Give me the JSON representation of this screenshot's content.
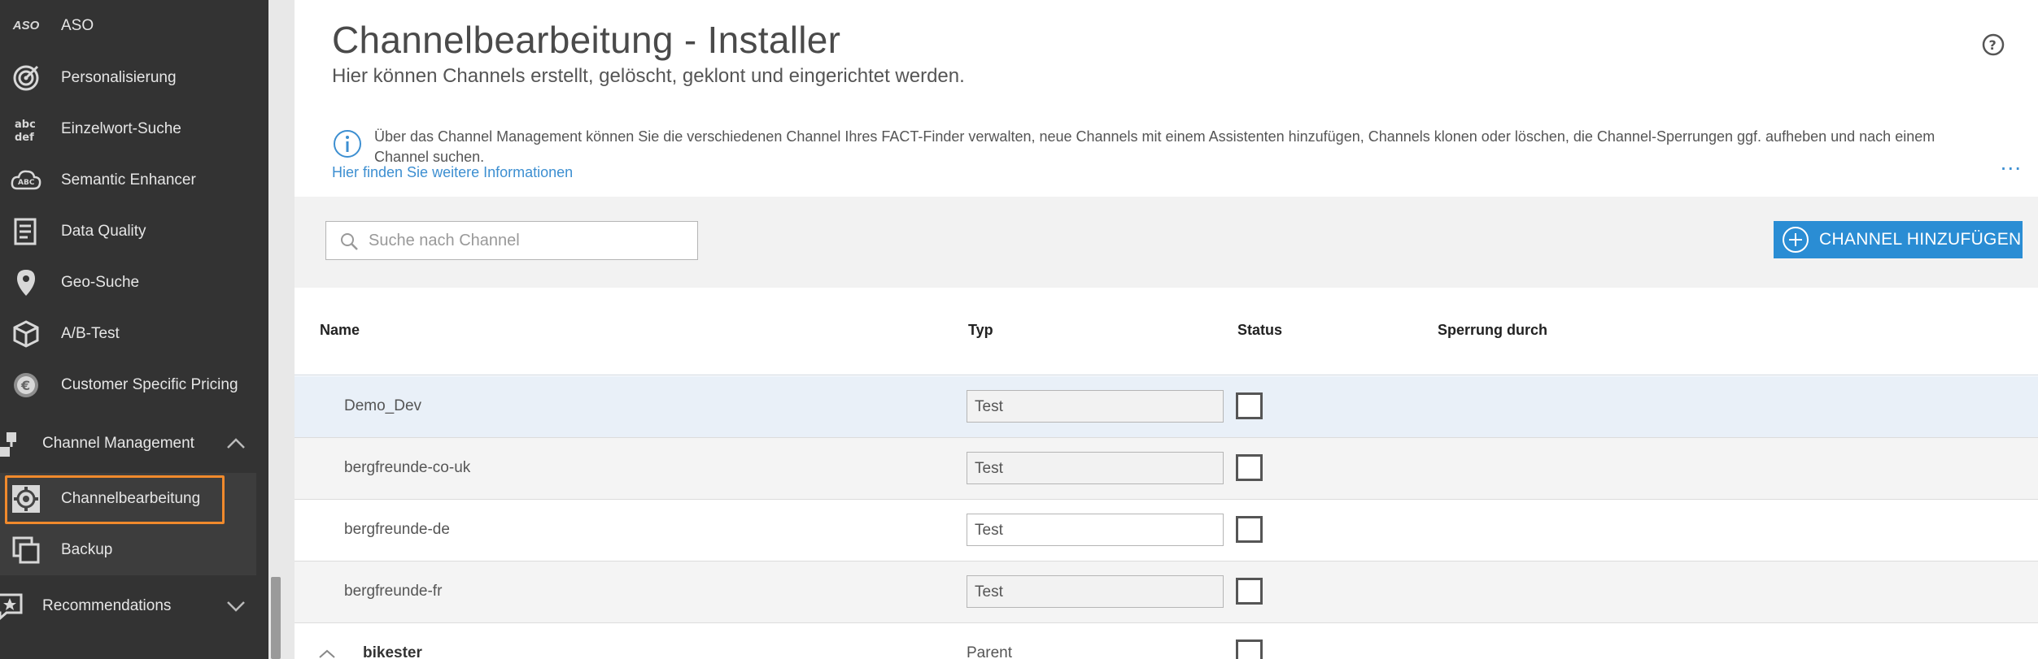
{
  "sidebar": {
    "items": [
      {
        "label": "ASO",
        "icon": "aso-text-icon"
      },
      {
        "label": "Personalisierung",
        "icon": "target-icon"
      },
      {
        "label": "Einzelwort-Suche",
        "icon": "abc-def-icon"
      },
      {
        "label": "Semantic Enhancer",
        "icon": "abc-cloud-icon"
      },
      {
        "label": "Data Quality",
        "icon": "document-check-icon"
      },
      {
        "label": "Geo-Suche",
        "icon": "location-pin-icon"
      },
      {
        "label": "A/B-Test",
        "icon": "cube-icon"
      },
      {
        "label": "Customer Specific Pricing",
        "icon": "euro-coin-icon"
      }
    ],
    "group_channel": {
      "label": "Channel Management",
      "icon": "hierarchy-icon"
    },
    "sub_items": [
      {
        "label": "Channelbearbeitung",
        "icon": "gear-icon"
      },
      {
        "label": "Backup",
        "icon": "copy-icon"
      }
    ],
    "group_recommendations": {
      "label": "Recommendations",
      "icon": "star-chat-icon"
    }
  },
  "header": {
    "title": "Channelbearbeitung - Installer",
    "subtitle": "Hier können Channels erstellt, gelöscht, geklont und eingerichtet werden."
  },
  "info": {
    "text": "Über das Channel Management können Sie die verschiedenen Channel Ihres FACT-Finder verwalten, neue Channels mit einem Assistenten hinzufügen, Channels klonen oder löschen, die Channel-Sperrungen ggf. aufheben und nach einem Channel suchen.",
    "link": "Hier finden Sie weitere Informationen",
    "more": "..."
  },
  "toolbar": {
    "search_placeholder": "Suche nach Channel",
    "add_label": "CHANNEL HINZUFÜGEN"
  },
  "table": {
    "columns": {
      "name": "Name",
      "typ": "Typ",
      "status": "Status",
      "lock": "Sperrung durch"
    },
    "rows": [
      {
        "name": "Demo_Dev",
        "typ": "Test"
      },
      {
        "name": "bergfreunde-co-uk",
        "typ": "Test"
      },
      {
        "name": "bergfreunde-de",
        "typ": "Test"
      },
      {
        "name": "bergfreunde-fr",
        "typ": "Test"
      }
    ],
    "parent_row": {
      "name": "bikester",
      "typ": "Parent"
    }
  },
  "colors": {
    "accent": "#2a8dd4",
    "highlight": "#f18a2c",
    "sidebar": "#333333"
  }
}
